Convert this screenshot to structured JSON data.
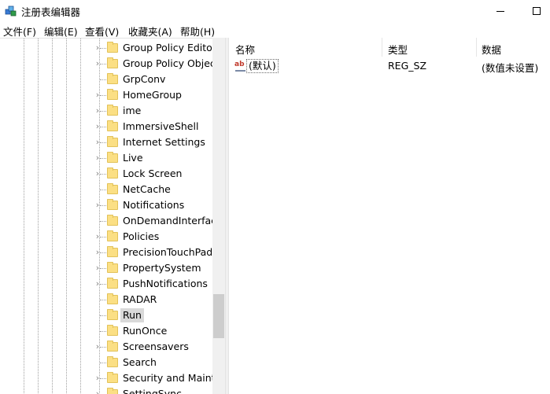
{
  "window": {
    "title": "注册表编辑器",
    "icon": "registry-editor-icon"
  },
  "menu": [
    "文件(F)",
    "编辑(E)",
    "查看(V)",
    "收藏夹(A)",
    "帮助(H)"
  ],
  "tree": {
    "items": [
      {
        "label": "Group Policy Editor",
        "expandable": true
      },
      {
        "label": "Group Policy Objects",
        "expandable": true
      },
      {
        "label": "GrpConv",
        "expandable": false
      },
      {
        "label": "HomeGroup",
        "expandable": true
      },
      {
        "label": "ime",
        "expandable": true
      },
      {
        "label": "ImmersiveShell",
        "expandable": true
      },
      {
        "label": "Internet Settings",
        "expandable": true
      },
      {
        "label": "Live",
        "expandable": true
      },
      {
        "label": "Lock Screen",
        "expandable": true
      },
      {
        "label": "NetCache",
        "expandable": false
      },
      {
        "label": "Notifications",
        "expandable": true
      },
      {
        "label": "OnDemandInterfaceCache",
        "expandable": false
      },
      {
        "label": "Policies",
        "expandable": true
      },
      {
        "label": "PrecisionTouchPad",
        "expandable": true
      },
      {
        "label": "PropertySystem",
        "expandable": true
      },
      {
        "label": "PushNotifications",
        "expandable": true
      },
      {
        "label": "RADAR",
        "expandable": false
      },
      {
        "label": "Run",
        "expandable": false,
        "selected": true
      },
      {
        "label": "RunOnce",
        "expandable": false
      },
      {
        "label": "Screensavers",
        "expandable": true
      },
      {
        "label": "Search",
        "expandable": false
      },
      {
        "label": "Security and Maintenance",
        "expandable": true
      },
      {
        "label": "SettingSync",
        "expandable": true
      }
    ]
  },
  "columns": {
    "name": "名称",
    "type": "类型",
    "data": "数据"
  },
  "values": [
    {
      "icon_text": "ab",
      "name": "(默认)",
      "type": "REG_SZ",
      "data": "(数值未设置)"
    }
  ]
}
